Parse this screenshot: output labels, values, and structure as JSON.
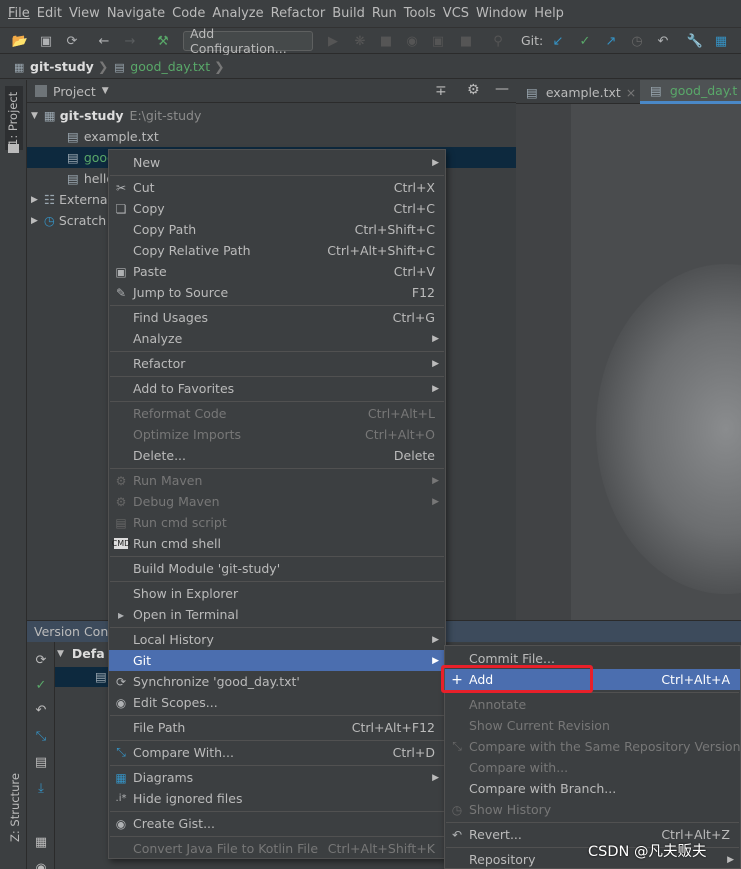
{
  "menubar": [
    "File",
    "Edit",
    "View",
    "Navigate",
    "Code",
    "Analyze",
    "Refactor",
    "Build",
    "Run",
    "Tools",
    "VCS",
    "Window",
    "Help"
  ],
  "toolbar": {
    "add_config": "Add Configuration...",
    "git_label": "Git:"
  },
  "navbar": {
    "project": "git-study",
    "file": "good_day.txt"
  },
  "leftstrip": {
    "project_tab": "1: Project",
    "structure_tab": "Z: Structure"
  },
  "project": {
    "header": "Project",
    "root_name": "git-study",
    "root_path": "E:\\git-study",
    "items": [
      "example.txt",
      "good",
      "hello",
      "Externa",
      "Scratch"
    ]
  },
  "editor": {
    "tabs": [
      "example.txt",
      "good_day.t"
    ]
  },
  "vc": {
    "header": "Version Cont",
    "row": "Defa"
  },
  "context_menu": {
    "items": [
      {
        "label": "New",
        "shortcut": "",
        "arrow": true
      },
      {
        "label": "Cut",
        "shortcut": "Ctrl+X",
        "icon": "cut-icon"
      },
      {
        "label": "Copy",
        "shortcut": "Ctrl+C",
        "icon": "copy-icon"
      },
      {
        "label": "Copy Path",
        "shortcut": "Ctrl+Shift+C"
      },
      {
        "label": "Copy Relative Path",
        "shortcut": "Ctrl+Alt+Shift+C"
      },
      {
        "label": "Paste",
        "shortcut": "Ctrl+V",
        "icon": "paste-icon"
      },
      {
        "label": "Jump to Source",
        "shortcut": "F12",
        "icon": "edit-icon"
      },
      {
        "label": "Find Usages",
        "shortcut": "Ctrl+G"
      },
      {
        "label": "Analyze",
        "shortcut": "",
        "arrow": true
      },
      {
        "label": "Refactor",
        "shortcut": "",
        "arrow": true
      },
      {
        "label": "Add to Favorites",
        "shortcut": "",
        "arrow": true
      },
      {
        "label": "Reformat Code",
        "shortcut": "Ctrl+Alt+L",
        "disabled": true
      },
      {
        "label": "Optimize Imports",
        "shortcut": "Ctrl+Alt+O",
        "disabled": true
      },
      {
        "label": "Delete...",
        "shortcut": "Delete"
      },
      {
        "label": "Run Maven",
        "shortcut": "",
        "arrow": true,
        "disabled": true,
        "icon": "gear-icon"
      },
      {
        "label": "Debug Maven",
        "shortcut": "",
        "arrow": true,
        "disabled": true,
        "icon": "gear-icon"
      },
      {
        "label": "Run cmd script",
        "shortcut": "",
        "disabled": true,
        "icon": "script-icon"
      },
      {
        "label": "Run cmd shell",
        "shortcut": "",
        "icon": "cmd-icon"
      },
      {
        "label": "Build Module 'git-study'",
        "shortcut": ""
      },
      {
        "label": "Show in Explorer",
        "shortcut": ""
      },
      {
        "label": "Open in Terminal",
        "shortcut": "",
        "icon": "terminal-icon"
      },
      {
        "label": "Local History",
        "shortcut": "",
        "arrow": true
      },
      {
        "label": "Git",
        "shortcut": "",
        "arrow": true
      },
      {
        "label": "Synchronize 'good_day.txt'",
        "shortcut": "",
        "icon": "sync-icon"
      },
      {
        "label": "Edit Scopes...",
        "shortcut": "",
        "icon": "scope-icon"
      },
      {
        "label": "File Path",
        "shortcut": "Ctrl+Alt+F12"
      },
      {
        "label": "Compare With...",
        "shortcut": "Ctrl+D",
        "icon": "compare-icon"
      },
      {
        "label": "Diagrams",
        "shortcut": "",
        "arrow": true,
        "icon": "diagram-icon"
      },
      {
        "label": "Hide ignored files",
        "shortcut": "",
        "icon": "ignore-icon"
      },
      {
        "label": "Create Gist...",
        "shortcut": "",
        "icon": "github-icon"
      },
      {
        "label": "Convert Java File to Kotlin File",
        "shortcut": "Ctrl+Alt+Shift+K",
        "disabled": true
      }
    ]
  },
  "git_submenu": {
    "items": [
      {
        "label": "Commit File...",
        "shortcut": ""
      },
      {
        "label": "Add",
        "shortcut": "Ctrl+Alt+A",
        "icon": "plus-icon"
      },
      {
        "label": "Annotate",
        "shortcut": "",
        "disabled": true
      },
      {
        "label": "Show Current Revision",
        "shortcut": "",
        "disabled": true
      },
      {
        "label": "Compare with the Same Repository Version",
        "shortcut": "",
        "disabled": true,
        "icon": "compare-icon"
      },
      {
        "label": "Compare with...",
        "shortcut": "",
        "disabled": true
      },
      {
        "label": "Compare with Branch...",
        "shortcut": ""
      },
      {
        "label": "Show History",
        "shortcut": "",
        "disabled": true,
        "icon": "history-icon"
      },
      {
        "label": "Revert...",
        "shortcut": "Ctrl+Alt+Z",
        "icon": "revert-icon"
      },
      {
        "label": "Repository",
        "shortcut": "",
        "arrow": true
      }
    ]
  },
  "watermark": "CSDN @凡夫贩夫",
  "colors": {
    "highlight": "#4b6eaf",
    "redbox": "#e8202a",
    "selection": "#0d293e"
  }
}
